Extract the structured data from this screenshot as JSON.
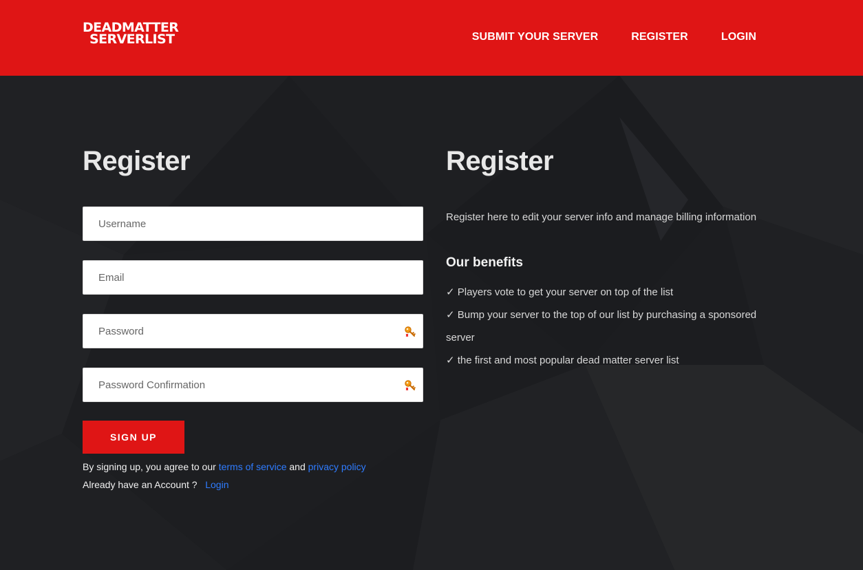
{
  "header": {
    "logo_line1": "DEADMATTER",
    "logo_line2": "SERVERLIST",
    "nav": [
      "SUBMIT YOUR SERVER",
      "REGISTER",
      "LOGIN"
    ],
    "brand_color": "#df1515"
  },
  "form": {
    "title": "Register",
    "fields": [
      {
        "placeholder": "Username",
        "value": ""
      },
      {
        "placeholder": "Email",
        "value": ""
      },
      {
        "placeholder": "Password",
        "value": ""
      },
      {
        "placeholder": "Password Confirmation",
        "value": ""
      }
    ],
    "submit_label": "SIGN UP",
    "terms_prefix": "By signing up, you agree to our",
    "terms_link": "terms of service",
    "terms_and": "and",
    "privacy_link": "privacy policy",
    "account_prefix": "Already have an Account ?",
    "login_link": "Login",
    "link_color": "#2f7cff"
  },
  "info": {
    "title": "Register",
    "intro": "Register here to edit your server info and manage billing information",
    "benefits_title": "Our benefits",
    "benefits": [
      "✓ Players vote to get your server on top of the list",
      "✓ Bump your server to the top of our list by purchasing a sponsored server",
      "✓ the first and most popular dead matter server list"
    ]
  },
  "icons": {
    "password_manager": "key-icon"
  }
}
